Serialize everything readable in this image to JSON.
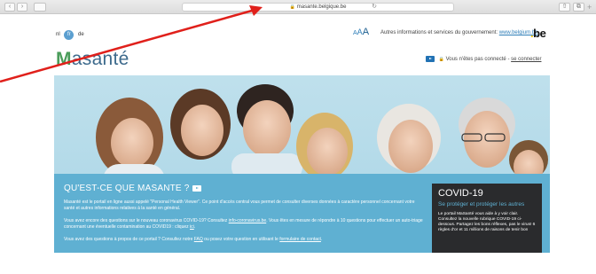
{
  "browser": {
    "url": "masante.belgique.be",
    "nav": {
      "back": "‹",
      "forward": "›"
    }
  },
  "header": {
    "lang_nl": "nl",
    "lang_fr": "fr",
    "lang_de": "de",
    "font_small": "A",
    "font_medium": "A",
    "font_large": "A",
    "gov_text": "Autres informations et services du gouvernement:",
    "gov_link": "www.belgium.be",
    "be_logo": "be"
  },
  "logo": {
    "first_letter": "M",
    "rest": "asanté"
  },
  "login": {
    "text": "Vous n'êtes pas connecté -",
    "link": "se connecter"
  },
  "panel": {
    "title": "QU'EST-CE QUE MASANTE ?",
    "p1": "Masanté est le portail en ligne aussi appelé \"Personal Health Viewer\". Ce point d'accès central vous permet de consulter diverses données à caractère personnel concernant votre santé et autres informations relatives à la santé en général.",
    "p2_a": "Vous avez encore des questions sur le nouveau coronavirus COVID-19? Consultez ",
    "p2_link": "info-coronavirus.be",
    "p2_b": ". Vous êtes en mesure de répondre à 10 questions pour effectuer un auto-triage concernant une éventuelle contamination au COVID19 : cliquez ",
    "p2_link2": "ici",
    "p2_c": ".",
    "p3_a": "Vous avez des questions à propos de ce portail ? Consultez notre ",
    "p3_faq": "FAQ",
    "p3_b": " ou posez votre question en utilisant le ",
    "p3_form": "formulaire de contact",
    "p3_c": "."
  },
  "covid": {
    "title": "COVID-19",
    "subtitle": "Se protéger et protéger les autres",
    "body": "Le portail MaSanté vous aide à y voir clair. Consultez la nouvelle rubrique COVID-19 ci-dessous. Partagez les bons réflexes, pas le virus! 6 règles d'or et 11 millions de raisons de tenir bon"
  },
  "colors": {
    "accent_blue": "#5fb0d2",
    "dark_box": "#2a2b2d",
    "annotation_arrow": "#e0201b"
  }
}
